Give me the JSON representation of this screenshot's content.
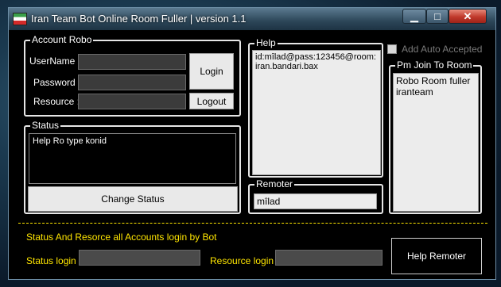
{
  "window": {
    "title": "Iran Team Bot Online Room Fuller | version 1.1",
    "controls": {
      "minimize": "▁",
      "maximize": "□",
      "close": "✕"
    }
  },
  "account": {
    "legend": "Account Robo",
    "username_label": "UserName :",
    "password_label": "Password :",
    "resource_label": "Resource :",
    "username_value": "",
    "password_value": "",
    "resource_value": "",
    "login_button": "Login",
    "logout_button": "Logout"
  },
  "status": {
    "legend": "Status",
    "text": "Help Ro type konid",
    "change_button": "Change Status"
  },
  "help": {
    "legend": "Help",
    "text": "id:mîlad@pass:123456@room:iran.bandari.bax"
  },
  "remoter": {
    "legend": "Remoter",
    "value": "mîlad"
  },
  "auto_accept": {
    "label": "Add Auto Accepted",
    "checked": false
  },
  "pm_join": {
    "legend": "Pm Join To Room",
    "text": "Robo Room fuller\niranteam"
  },
  "bottom": {
    "caption": "Status And Resorce all Accounts login by Bot",
    "status_login_label": "Status login :",
    "resource_login_label": "Resource login :",
    "status_login_value": "",
    "resource_login_value": "",
    "help_remoter_button": "Help Remoter"
  },
  "colors": {
    "accent_text": "#ffe600",
    "window_bg": "#000000",
    "close_button": "#c0392b"
  }
}
